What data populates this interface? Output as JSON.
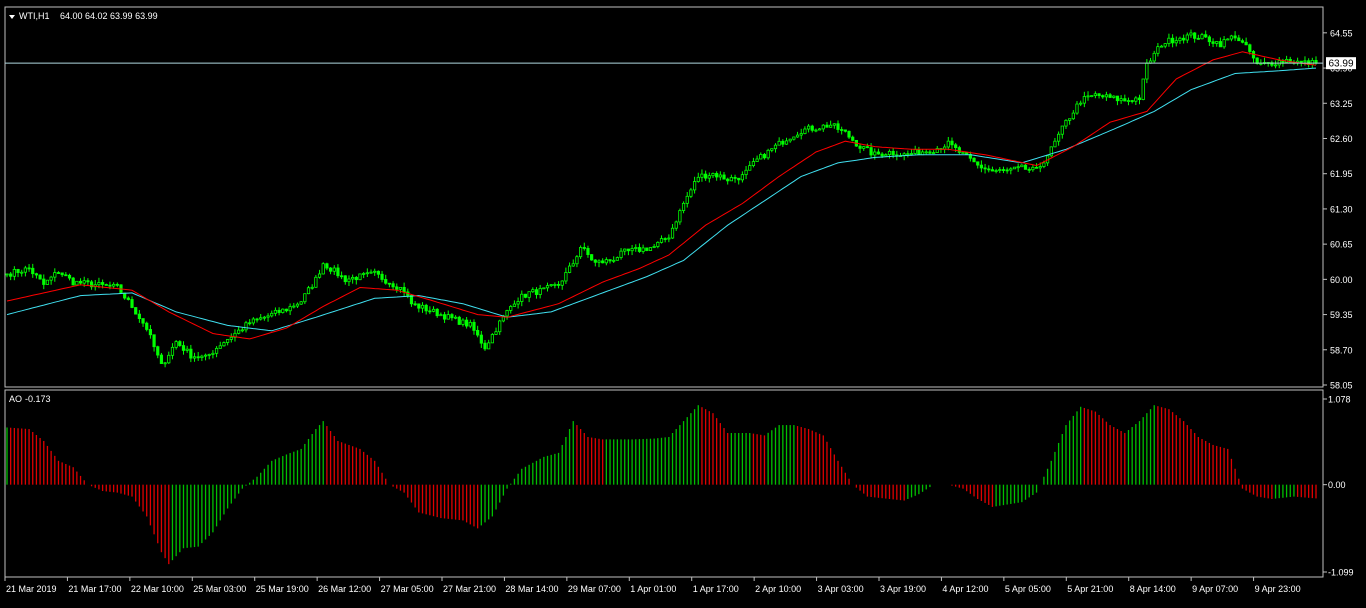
{
  "window": {
    "symbol_label": "WTI,H1",
    "ohlc_label": "64.00 64.02 63.99 63.99",
    "price_tag": "63.99"
  },
  "colors": {
    "background": "#000000",
    "frame": "#c0c0c0",
    "candle": "#00ff00",
    "ma_fast": "#ff0000",
    "ma_slow": "#40e0f0",
    "bid_line": "#b0d8e0",
    "ao_up": "#00c000",
    "ao_down": "#e00000",
    "text": "#ffffff"
  },
  "chart_data": [
    {
      "type": "candlestick",
      "title": "WTI,H1",
      "ylim": [
        58.05,
        64.75
      ],
      "y_ticks": [
        "64.55",
        "63.90",
        "63.25",
        "62.60",
        "61.95",
        "61.30",
        "60.65",
        "60.00",
        "59.35",
        "58.70",
        "58.05"
      ],
      "x_ticks": [
        "21 Mar 2019",
        "21 Mar 17:00",
        "22 Mar 10:00",
        "25 Mar 03:00",
        "25 Mar 19:00",
        "26 Mar 12:00",
        "27 Mar 05:00",
        "27 Mar 21:00",
        "28 Mar 14:00",
        "29 Mar 07:00",
        "1 Apr 01:00",
        "1 Apr 17:00",
        "2 Apr 10:00",
        "3 Apr 03:00",
        "3 Apr 19:00",
        "4 Apr 12:00",
        "5 Apr 05:00",
        "5 Apr 21:00",
        "8 Apr 14:00",
        "9 Apr 07:00",
        "9 Apr 23:00"
      ],
      "last_price": 63.99,
      "close_anchors": [
        [
          0,
          60.1
        ],
        [
          6,
          60.2
        ],
        [
          10,
          59.9
        ],
        [
          14,
          60.15
        ],
        [
          18,
          59.95
        ],
        [
          24,
          59.9
        ],
        [
          30,
          59.85
        ],
        [
          34,
          59.5
        ],
        [
          38,
          59.1
        ],
        [
          42,
          58.4
        ],
        [
          46,
          58.85
        ],
        [
          50,
          58.6
        ],
        [
          54,
          58.55
        ],
        [
          58,
          58.8
        ],
        [
          62,
          59.0
        ],
        [
          66,
          59.2
        ],
        [
          70,
          59.3
        ],
        [
          76,
          59.45
        ],
        [
          80,
          59.6
        ],
        [
          84,
          60.0
        ],
        [
          86,
          60.3
        ],
        [
          88,
          60.2
        ],
        [
          92,
          60.0
        ],
        [
          96,
          60.05
        ],
        [
          100,
          60.1
        ],
        [
          104,
          59.95
        ],
        [
          108,
          59.8
        ],
        [
          110,
          59.55
        ],
        [
          114,
          59.45
        ],
        [
          118,
          59.35
        ],
        [
          122,
          59.25
        ],
        [
          126,
          59.15
        ],
        [
          130,
          58.75
        ],
        [
          134,
          59.2
        ],
        [
          138,
          59.6
        ],
        [
          142,
          59.75
        ],
        [
          146,
          59.8
        ],
        [
          150,
          59.9
        ],
        [
          154,
          60.3
        ],
        [
          156,
          60.6
        ],
        [
          160,
          60.3
        ],
        [
          164,
          60.35
        ],
        [
          168,
          60.5
        ],
        [
          172,
          60.55
        ],
        [
          176,
          60.6
        ],
        [
          180,
          60.8
        ],
        [
          184,
          61.4
        ],
        [
          188,
          61.9
        ],
        [
          192,
          61.95
        ],
        [
          196,
          61.85
        ],
        [
          200,
          61.9
        ],
        [
          204,
          62.2
        ],
        [
          208,
          62.4
        ],
        [
          212,
          62.6
        ],
        [
          216,
          62.75
        ],
        [
          220,
          62.8
        ],
        [
          224,
          62.85
        ],
        [
          228,
          62.7
        ],
        [
          232,
          62.45
        ],
        [
          236,
          62.3
        ],
        [
          240,
          62.35
        ],
        [
          244,
          62.3
        ],
        [
          248,
          62.35
        ],
        [
          252,
          62.4
        ],
        [
          256,
          62.5
        ],
        [
          260,
          62.3
        ],
        [
          264,
          62.1
        ],
        [
          268,
          62.0
        ],
        [
          272,
          62.0
        ],
        [
          276,
          62.05
        ],
        [
          280,
          62.0
        ],
        [
          284,
          62.4
        ],
        [
          288,
          62.9
        ],
        [
          292,
          63.3
        ],
        [
          296,
          63.4
        ],
        [
          300,
          63.35
        ],
        [
          304,
          63.3
        ],
        [
          308,
          63.35
        ],
        [
          310,
          63.95
        ],
        [
          314,
          64.35
        ],
        [
          318,
          64.45
        ],
        [
          322,
          64.5
        ],
        [
          326,
          64.45
        ],
        [
          330,
          64.35
        ],
        [
          334,
          64.5
        ],
        [
          338,
          64.2
        ],
        [
          340,
          63.95
        ],
        [
          344,
          64.0
        ],
        [
          348,
          64.05
        ],
        [
          352,
          64.0
        ],
        [
          356,
          63.99
        ]
      ],
      "ma_fast_anchors": [
        [
          0,
          59.6
        ],
        [
          20,
          59.9
        ],
        [
          34,
          59.8
        ],
        [
          44,
          59.4
        ],
        [
          56,
          59.0
        ],
        [
          66,
          58.9
        ],
        [
          76,
          59.1
        ],
        [
          86,
          59.5
        ],
        [
          96,
          59.85
        ],
        [
          106,
          59.8
        ],
        [
          116,
          59.6
        ],
        [
          128,
          59.35
        ],
        [
          136,
          59.3
        ],
        [
          150,
          59.55
        ],
        [
          162,
          59.95
        ],
        [
          172,
          60.2
        ],
        [
          180,
          60.45
        ],
        [
          190,
          61.0
        ],
        [
          200,
          61.4
        ],
        [
          210,
          61.9
        ],
        [
          220,
          62.35
        ],
        [
          228,
          62.55
        ],
        [
          236,
          62.45
        ],
        [
          246,
          62.4
        ],
        [
          256,
          62.4
        ],
        [
          266,
          62.3
        ],
        [
          280,
          62.1
        ],
        [
          290,
          62.45
        ],
        [
          300,
          62.9
        ],
        [
          310,
          63.1
        ],
        [
          318,
          63.7
        ],
        [
          328,
          64.05
        ],
        [
          336,
          64.2
        ],
        [
          346,
          64.05
        ],
        [
          356,
          63.95
        ]
      ],
      "ma_slow_anchors": [
        [
          0,
          59.35
        ],
        [
          20,
          59.7
        ],
        [
          34,
          59.75
        ],
        [
          46,
          59.4
        ],
        [
          60,
          59.15
        ],
        [
          72,
          59.05
        ],
        [
          84,
          59.3
        ],
        [
          100,
          59.65
        ],
        [
          112,
          59.7
        ],
        [
          124,
          59.55
        ],
        [
          136,
          59.3
        ],
        [
          148,
          59.4
        ],
        [
          160,
          59.7
        ],
        [
          174,
          60.05
        ],
        [
          184,
          60.35
        ],
        [
          196,
          61.0
        ],
        [
          206,
          61.45
        ],
        [
          216,
          61.9
        ],
        [
          226,
          62.15
        ],
        [
          236,
          62.25
        ],
        [
          248,
          62.3
        ],
        [
          262,
          62.3
        ],
        [
          276,
          62.15
        ],
        [
          288,
          62.4
        ],
        [
          302,
          62.8
        ],
        [
          312,
          63.1
        ],
        [
          322,
          63.5
        ],
        [
          334,
          63.8
        ],
        [
          346,
          63.85
        ],
        [
          356,
          63.9
        ]
      ]
    },
    {
      "type": "bar",
      "title": "AO",
      "current_value_label": "-0.173",
      "ylim": [
        -1.099,
        1.078
      ],
      "y_ticks": [
        "1.078",
        "0.00",
        "-1.099"
      ],
      "value_anchors": [
        [
          0,
          0.72
        ],
        [
          6,
          0.7
        ],
        [
          10,
          0.55
        ],
        [
          14,
          0.3
        ],
        [
          18,
          0.22
        ],
        [
          22,
          0.0
        ],
        [
          26,
          -0.08
        ],
        [
          30,
          -0.1
        ],
        [
          34,
          -0.15
        ],
        [
          38,
          -0.4
        ],
        [
          42,
          -0.85
        ],
        [
          44,
          -1.0
        ],
        [
          48,
          -0.8
        ],
        [
          52,
          -0.78
        ],
        [
          56,
          -0.6
        ],
        [
          60,
          -0.3
        ],
        [
          64,
          -0.05
        ],
        [
          68,
          0.1
        ],
        [
          72,
          0.3
        ],
        [
          76,
          0.38
        ],
        [
          80,
          0.45
        ],
        [
          84,
          0.7
        ],
        [
          86,
          0.8
        ],
        [
          90,
          0.55
        ],
        [
          96,
          0.45
        ],
        [
          100,
          0.3
        ],
        [
          104,
          0.0
        ],
        [
          108,
          -0.1
        ],
        [
          112,
          -0.35
        ],
        [
          118,
          -0.42
        ],
        [
          124,
          -0.45
        ],
        [
          128,
          -0.55
        ],
        [
          132,
          -0.4
        ],
        [
          136,
          -0.05
        ],
        [
          140,
          0.2
        ],
        [
          146,
          0.35
        ],
        [
          150,
          0.4
        ],
        [
          154,
          0.8
        ],
        [
          158,
          0.6
        ],
        [
          162,
          0.57
        ],
        [
          170,
          0.57
        ],
        [
          176,
          0.58
        ],
        [
          180,
          0.6
        ],
        [
          184,
          0.8
        ],
        [
          188,
          1.0
        ],
        [
          192,
          0.9
        ],
        [
          196,
          0.65
        ],
        [
          202,
          0.65
        ],
        [
          206,
          0.62
        ],
        [
          210,
          0.75
        ],
        [
          214,
          0.75
        ],
        [
          218,
          0.7
        ],
        [
          222,
          0.62
        ],
        [
          226,
          0.3
        ],
        [
          230,
          0.0
        ],
        [
          234,
          -0.15
        ],
        [
          240,
          -0.18
        ],
        [
          244,
          -0.2
        ],
        [
          248,
          -0.12
        ],
        [
          252,
          0.0
        ],
        [
          256,
          0.0
        ],
        [
          260,
          -0.05
        ],
        [
          264,
          -0.18
        ],
        [
          268,
          -0.28
        ],
        [
          272,
          -0.25
        ],
        [
          276,
          -0.22
        ],
        [
          280,
          -0.1
        ],
        [
          284,
          0.3
        ],
        [
          288,
          0.75
        ],
        [
          292,
          0.98
        ],
        [
          296,
          0.92
        ],
        [
          300,
          0.75
        ],
        [
          304,
          0.65
        ],
        [
          308,
          0.8
        ],
        [
          312,
          1.0
        ],
        [
          316,
          0.95
        ],
        [
          320,
          0.8
        ],
        [
          324,
          0.6
        ],
        [
          328,
          0.5
        ],
        [
          332,
          0.45
        ],
        [
          336,
          -0.05
        ],
        [
          340,
          -0.15
        ],
        [
          344,
          -0.18
        ],
        [
          350,
          -0.15
        ],
        [
          356,
          -0.173
        ]
      ]
    }
  ]
}
